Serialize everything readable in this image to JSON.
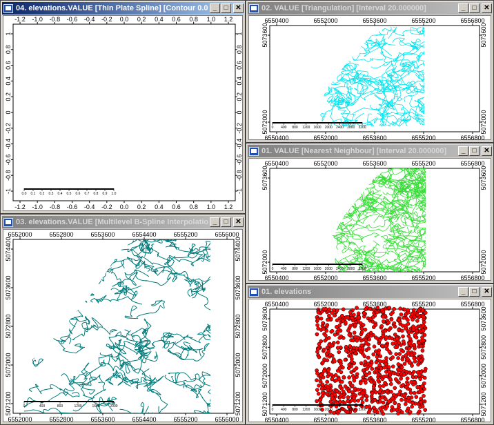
{
  "windows": {
    "w04": {
      "title": "04. elevations.VALUE [Thin Plate Spline] [Contour 0.0...",
      "x_ticks": [
        "-1.2",
        "-1.0",
        "-0.8",
        "-0.6",
        "-0.4",
        "-0.2",
        "0.0",
        "0.2",
        "0.4",
        "0.6",
        "0.8",
        "1.0",
        "1.2"
      ],
      "y_ticks": [
        "1",
        "0.8",
        "0.6",
        "0.4",
        "0.2",
        "0",
        "-0.2",
        "-0.4",
        "-0.6",
        "-0.8",
        "-1"
      ],
      "scale_labels": [
        "0.0",
        "0.1",
        "0.2",
        "0.3",
        "0.4",
        "0.5",
        "0.6",
        "0.7",
        "0.8",
        "0.9",
        "1.0"
      ]
    },
    "w02": {
      "title": "02. VALUE [Triangulation] [Interval 20.000000]",
      "x_ticks": [
        "6550400",
        "6552000",
        "6553600",
        "6555200",
        "6556800"
      ],
      "y_ticks": [
        "5073600",
        "5072000"
      ],
      "scale_labels": [
        "0",
        "400",
        "800",
        "1200",
        "1600",
        "2000",
        "2400",
        "2800",
        "3200"
      ],
      "line_color": "#00e5ee"
    },
    "w01nn": {
      "title": "01. VALUE [Nearest Neighbour] [Interval 20.000000]",
      "x_ticks": [
        "6550400",
        "6552000",
        "6553600",
        "6555200",
        "6556800"
      ],
      "y_ticks": [
        "5073600",
        "5072000"
      ],
      "scale_labels": [
        "0",
        "400",
        "800",
        "1200",
        "1600",
        "2000",
        "2400",
        "2800",
        "3200"
      ],
      "line_color": "#33dd33"
    },
    "w03": {
      "title": "03. elevations.VALUE [Multilevel B-Spline Interpolatio...",
      "x_ticks": [
        "6552000",
        "6552800",
        "6553600",
        "6554400",
        "6555200",
        "6556000"
      ],
      "y_ticks": [
        "5074400",
        "5073600",
        "5072800",
        "5072000",
        "5071200"
      ],
      "scale_labels": [
        "0",
        "400",
        "800",
        "1200",
        "1600",
        "2000"
      ],
      "line_color": "#007a7a"
    },
    "w01": {
      "title": "01. elevations",
      "x_ticks": [
        "6550400",
        "6552000",
        "6553600",
        "6555200",
        "6556800"
      ],
      "y_ticks": [
        "5073600",
        "5072800",
        "5072000",
        "5071200"
      ],
      "scale_labels": [
        "0",
        "400",
        "800",
        "1200",
        "1600",
        "2000",
        "2400",
        "2800",
        "3200"
      ],
      "fill_color": "#ff0000"
    }
  },
  "caption_buttons": {
    "minimize": "_",
    "maximize": "□",
    "close": "✕"
  }
}
